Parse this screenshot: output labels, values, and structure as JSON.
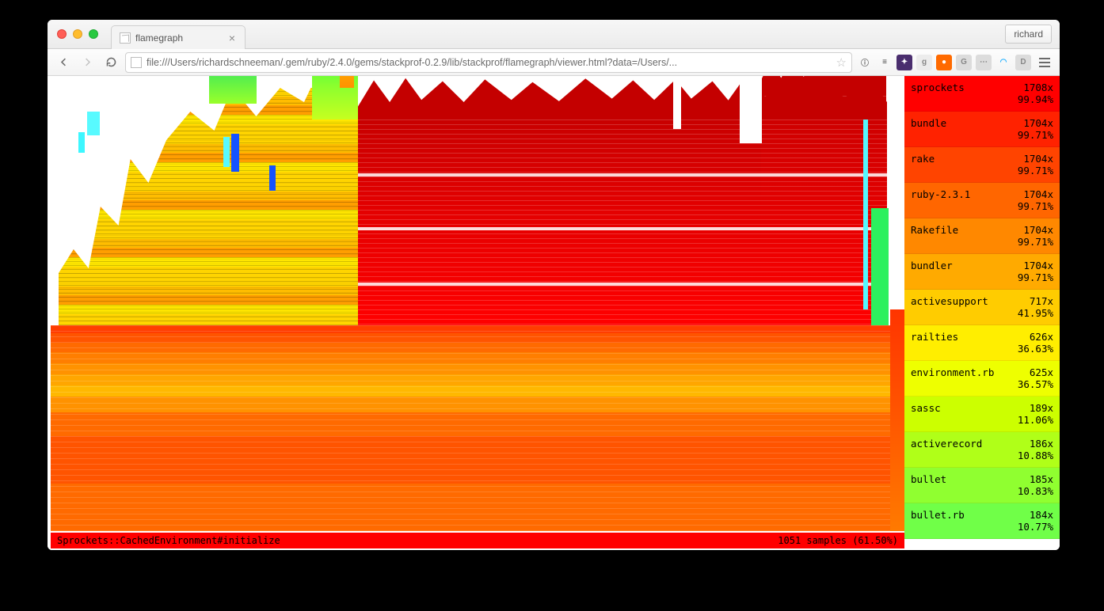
{
  "browser": {
    "tab_title": "flamegraph",
    "user_button": "richard",
    "url": "file:///Users/richardschneeman/.gem/ruby/2.4.0/gems/stackprof-0.2.9/lib/stackprof/flamegraph/viewer.html?data=/Users/..."
  },
  "status": {
    "method": "Sprockets::CachedEnvironment#initialize",
    "samples": "1051 samples (61.50%)"
  },
  "legend": [
    {
      "name": "sprockets",
      "count": "1708x",
      "pct": "99.94%",
      "color": "#ff0000"
    },
    {
      "name": "bundle",
      "count": "1704x",
      "pct": "99.71%",
      "color": "#ff2200"
    },
    {
      "name": "rake",
      "count": "1704x",
      "pct": "99.71%",
      "color": "#ff4400"
    },
    {
      "name": "ruby-2.3.1",
      "count": "1704x",
      "pct": "99.71%",
      "color": "#ff6600"
    },
    {
      "name": "Rakefile",
      "count": "1704x",
      "pct": "99.71%",
      "color": "#ff8800"
    },
    {
      "name": "bundler",
      "count": "1704x",
      "pct": "99.71%",
      "color": "#ffaa00"
    },
    {
      "name": "activesupport",
      "count": "717x",
      "pct": "41.95%",
      "color": "#ffcc00"
    },
    {
      "name": "railties",
      "count": "626x",
      "pct": "36.63%",
      "color": "#ffee00"
    },
    {
      "name": "environment.rb",
      "count": "625x",
      "pct": "36.57%",
      "color": "#eeff00"
    },
    {
      "name": "sassc",
      "count": "189x",
      "pct": "11.06%",
      "color": "#ccff00"
    },
    {
      "name": "activerecord",
      "count": "186x",
      "pct": "10.88%",
      "color": "#b0ff18"
    },
    {
      "name": "bullet",
      "count": "185x",
      "pct": "10.83%",
      "color": "#90ff30"
    },
    {
      "name": "bullet.rb",
      "count": "184x",
      "pct": "10.77%",
      "color": "#70ff48"
    }
  ],
  "ext_icons": [
    {
      "label": "ⓘ",
      "bg": "transparent",
      "fg": "#6a6a6a"
    },
    {
      "label": "≡",
      "bg": "transparent",
      "fg": "#444"
    },
    {
      "label": "✦",
      "bg": "#4a2e6e",
      "fg": "#fff"
    },
    {
      "label": "g",
      "bg": "#ececec",
      "fg": "#888"
    },
    {
      "label": "●",
      "bg": "#ff6a00",
      "fg": "#fff"
    },
    {
      "label": "G",
      "bg": "#dcdcdc",
      "fg": "#888"
    },
    {
      "label": "⋯",
      "bg": "#dcdcdc",
      "fg": "#888"
    },
    {
      "label": "◠",
      "bg": "transparent",
      "fg": "#21b0ff"
    },
    {
      "label": "D",
      "bg": "#dcdcdc",
      "fg": "#888"
    }
  ]
}
